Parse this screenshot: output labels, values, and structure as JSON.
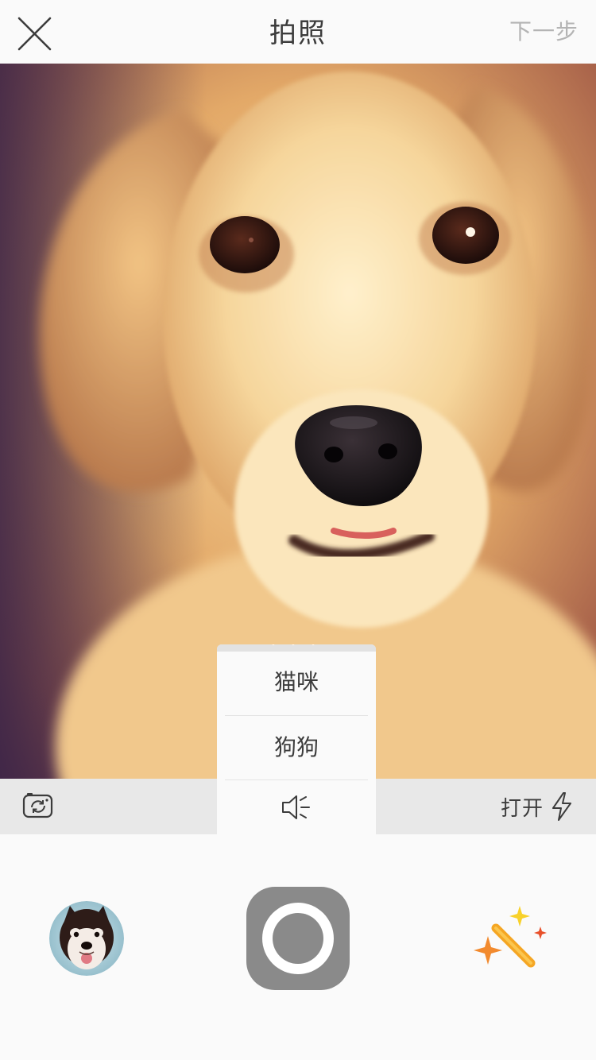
{
  "header": {
    "title": "拍照",
    "next_label": "下一步",
    "close_icon": "close-icon"
  },
  "viewfinder": {
    "subject": "dog-photo"
  },
  "controls": {
    "switch_camera_icon": "camera-switch-icon",
    "flash_label": "打开",
    "flash_icon": "flash-icon"
  },
  "popup": {
    "items": [
      {
        "label": "猫咪"
      },
      {
        "label": "狗狗"
      }
    ],
    "sound_icon": "sound-icon"
  },
  "bottom": {
    "gallery_icon": "gallery-thumbnail",
    "shutter_icon": "shutter-icon",
    "magic_icon": "magic-wand-icon"
  },
  "colors": {
    "title_text": "#3c3c3c",
    "next_text": "#b4b4b4",
    "strip_bg": "#e8e8e8",
    "shutter": "#8a8a8a",
    "wand_orange": "#f5a623",
    "sparkle_yellow": "#f8d12a",
    "sparkle_red": "#e8502a"
  }
}
